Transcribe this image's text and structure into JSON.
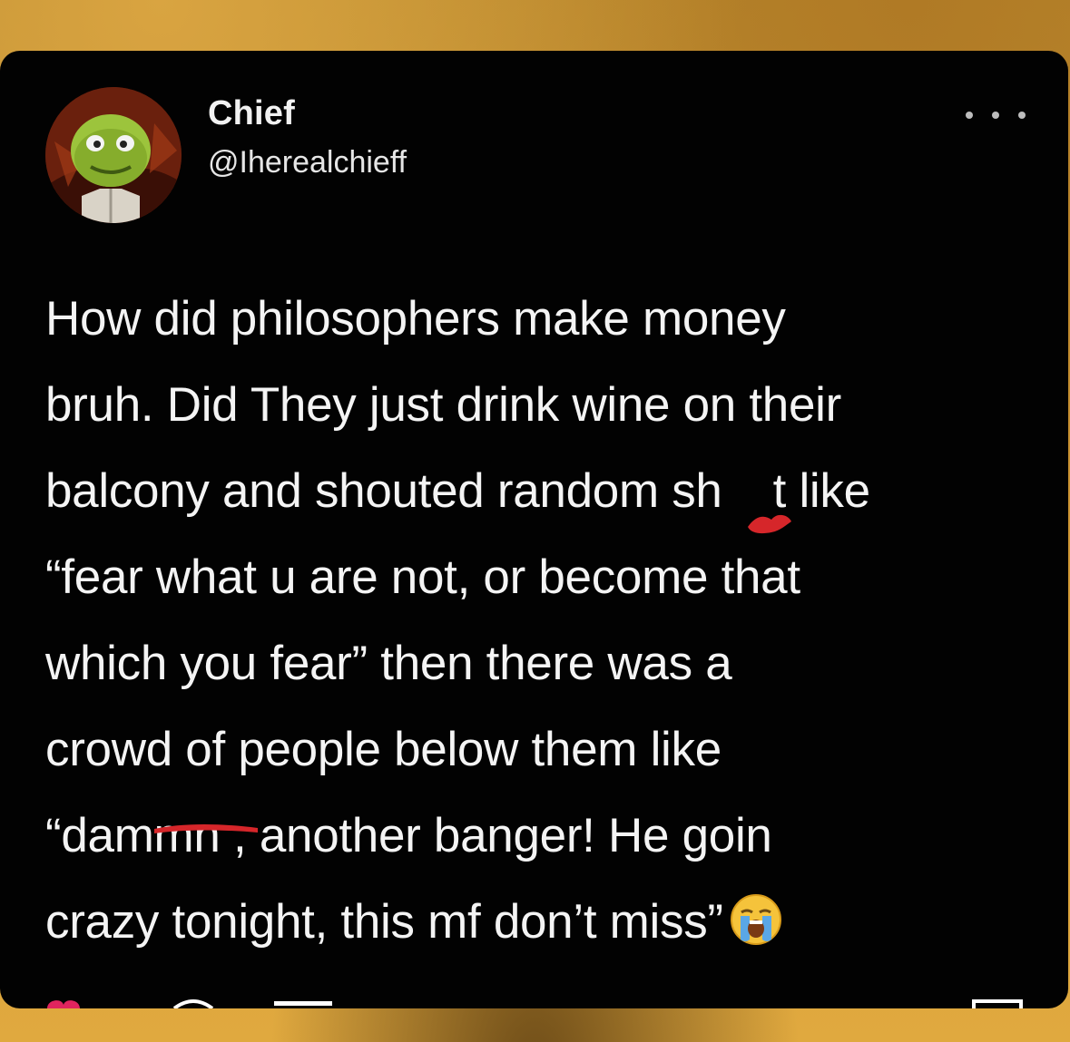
{
  "tweet": {
    "author": {
      "display_name": "Chief",
      "handle": "@Iherealchieff"
    },
    "text_lines": {
      "l1": "How did philosophers make money",
      "l2": "bruh. Did They just drink wine on their",
      "l3_a": "balcony and shouted random sh",
      "l3_b": "t like",
      "l4": "“fear what u are not, or become that",
      "l5": "which you fear” then there was a",
      "l6": "crowd of people below them like",
      "l7_a": "“da",
      "l7_b": "mmn , another banger! He goin",
      "l8": "crazy tonight, this mf don’t miss”"
    },
    "emoji_icon": "loudly-crying-face-icon"
  },
  "icons": {
    "more": "more-options-icon",
    "like": "heart-icon",
    "reply": "reply-icon",
    "retweet": "retweet-icon",
    "share": "share-icon"
  },
  "colors": {
    "card_background": "#020202",
    "text": "#f4f4f4",
    "censor_red": "#d6262a",
    "like_red": "#e0245e"
  }
}
